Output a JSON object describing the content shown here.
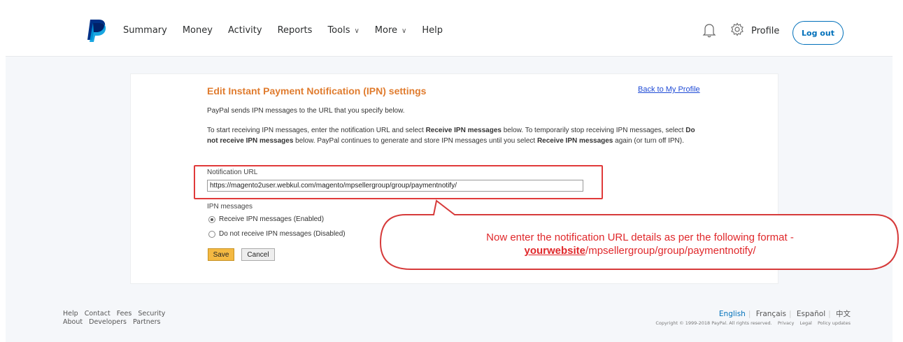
{
  "nav": {
    "items": [
      {
        "label": "Summary",
        "dropdown": false
      },
      {
        "label": "Money",
        "dropdown": false
      },
      {
        "label": "Activity",
        "dropdown": false
      },
      {
        "label": "Reports",
        "dropdown": false
      },
      {
        "label": "Tools",
        "dropdown": true
      },
      {
        "label": "More",
        "dropdown": true
      },
      {
        "label": "Help",
        "dropdown": false
      }
    ],
    "profile_label": "Profile",
    "logout_label": "Log out"
  },
  "form": {
    "title": "Edit Instant Payment Notification (IPN) settings",
    "back_link": "Back to My Profile",
    "intro": "PayPal sends IPN messages to the URL that you specify below.",
    "instructions": {
      "t1": "To start receiving IPN messages, enter the notification URL and select ",
      "b1": "Receive IPN messages",
      "t2": " below. To temporarily stop receiving IPN messages, select ",
      "b2": "Do not receive IPN messages",
      "t3": " below. PayPal continues to generate and store IPN messages until you select ",
      "b3": "Receive IPN messages",
      "t4": " again (or turn off IPN)."
    },
    "notification_url_label": "Notification URL",
    "notification_url_value": "https://magento2user.webkul.com/magento/mpsellergroup/group/paymentnotify/",
    "ipn_messages_label": "IPN messages",
    "radio_enabled": "Receive IPN messages (Enabled)",
    "radio_disabled": "Do not receive IPN messages (Disabled)",
    "selected": "enabled",
    "save_label": "Save",
    "cancel_label": "Cancel"
  },
  "callout": {
    "line1": "Now enter the notification URL details as per the following format -",
    "line2_bold": "yourwebsite",
    "line2_rest": "/mpsellergroup/group/paymentnotify/"
  },
  "footer": {
    "links_row1": [
      "Help",
      "Contact",
      "Fees",
      "Security"
    ],
    "links_row2": [
      "About",
      "Developers",
      "Partners"
    ],
    "languages": [
      "English",
      "Français",
      "Español",
      "中文"
    ],
    "copyright": "Copyright © 1999-2018 PayPal. All rights reserved.",
    "legal_links": [
      "Privacy",
      "Legal",
      "Policy updates"
    ]
  },
  "colors": {
    "brand_blue": "#0070ba",
    "title_orange": "#e07c2f",
    "callout_red": "#e0282b"
  }
}
